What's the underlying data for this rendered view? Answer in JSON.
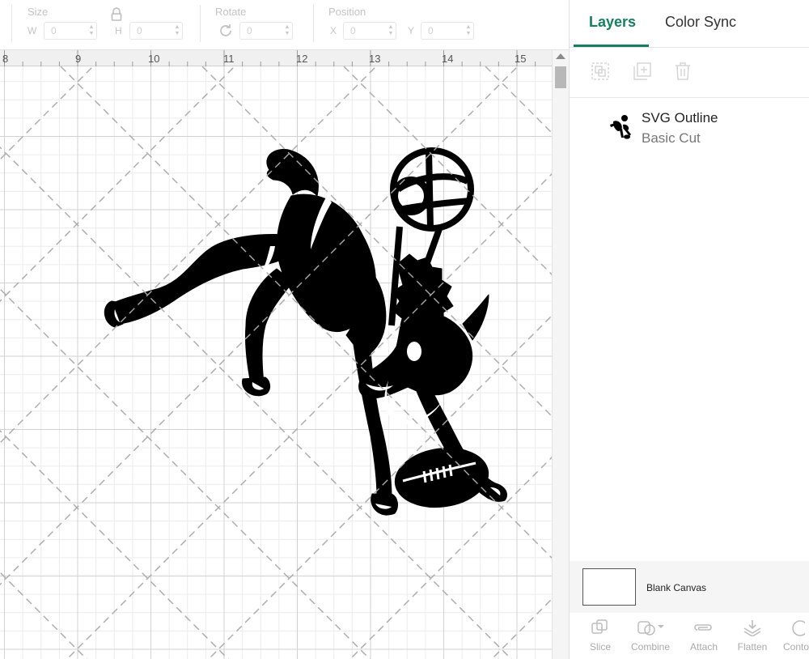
{
  "toolbar": {
    "size_label": "Size",
    "w_label": "W",
    "w_value": "0",
    "h_label": "H",
    "h_value": "0",
    "rotate_label": "Rotate",
    "rotate_value": "0",
    "position_label": "Position",
    "x_label": "X",
    "x_value": "0",
    "y_label": "Y",
    "y_value": "0"
  },
  "ruler": {
    "ticks": [
      "8",
      "9",
      "10",
      "11",
      "12",
      "13",
      "14",
      "15"
    ]
  },
  "panel": {
    "tabs": {
      "layers": "Layers",
      "color_sync": "Color Sync"
    },
    "layer": {
      "name": "SVG Outline",
      "operation": "Basic Cut"
    },
    "canvas": {
      "label": "Blank Canvas"
    },
    "tools": {
      "slice": "Slice",
      "combine": "Combine",
      "attach": "Attach",
      "flatten": "Flatten",
      "contour": "Contour"
    }
  },
  "colors": {
    "accent": "#15805f",
    "grid_major": "#d2d2d2",
    "grid_minor": "#ececec",
    "watermark": "#a9a9a9",
    "artwork": "#000000"
  }
}
